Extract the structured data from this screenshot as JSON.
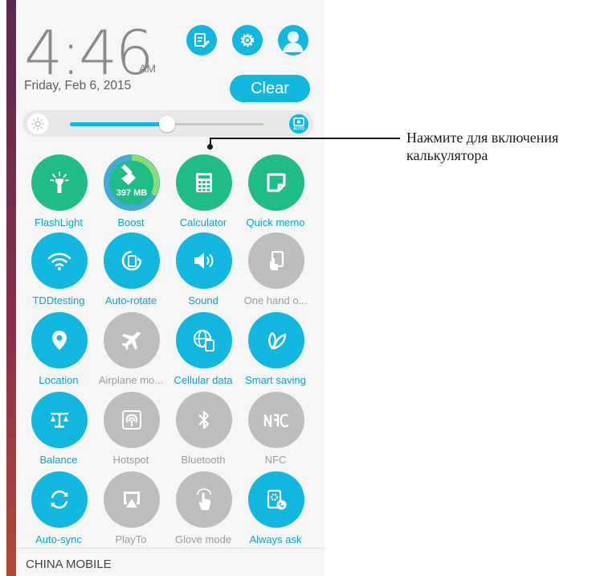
{
  "status": {
    "time": "4:46",
    "ampm": "AM",
    "date": "Friday, Feb 6, 2015"
  },
  "header": {
    "clear_label": "Clear"
  },
  "brightness": {
    "level": 0.5,
    "auto_label": "AUTO"
  },
  "tiles": [
    {
      "label": "FlashLight",
      "icon": "flashlight-icon",
      "active": true
    },
    {
      "label": "Boost",
      "icon": "boost-icon",
      "active": true,
      "memory": "397 MB"
    },
    {
      "label": "Calculator",
      "icon": "calculator-icon",
      "active": true
    },
    {
      "label": "Quick memo",
      "icon": "quick-memo-icon",
      "active": true
    },
    {
      "label": "TDDtesting",
      "icon": "wifi-icon",
      "active": true
    },
    {
      "label": "Auto-rotate",
      "icon": "auto-rotate-icon",
      "active": true
    },
    {
      "label": "Sound",
      "icon": "sound-icon",
      "active": true
    },
    {
      "label": "One hand o...",
      "icon": "one-hand-icon",
      "active": false
    },
    {
      "label": "Location",
      "icon": "location-icon",
      "active": true
    },
    {
      "label": "Airplane mo...",
      "icon": "airplane-icon",
      "active": false
    },
    {
      "label": "Cellular data",
      "icon": "cellular-data-icon",
      "active": true
    },
    {
      "label": "Smart saving",
      "icon": "smart-saving-icon",
      "active": true
    },
    {
      "label": "Balance",
      "icon": "balance-icon",
      "active": true
    },
    {
      "label": "Hotspot",
      "icon": "hotspot-icon",
      "active": false
    },
    {
      "label": "Bluetooth",
      "icon": "bluetooth-icon",
      "active": false
    },
    {
      "label": "NFC",
      "icon": "nfc-icon",
      "active": false
    },
    {
      "label": "Auto-sync",
      "icon": "auto-sync-icon",
      "active": true
    },
    {
      "label": "PlayTo",
      "icon": "playto-icon",
      "active": false
    },
    {
      "label": "Glove mode",
      "icon": "glove-mode-icon",
      "active": false
    },
    {
      "label": "Always ask",
      "icon": "always-ask-icon",
      "active": true
    }
  ],
  "footer": {
    "carrier": "CHINA MOBILE"
  },
  "annotation": {
    "text": "Нажмите для включения калькулятора"
  },
  "colors": {
    "accent": "#12b7df",
    "green": "#1fbc86",
    "inactive": "#bdbdbd",
    "label_active": "#0aa3c9",
    "label_inactive": "#9b9b9b"
  }
}
